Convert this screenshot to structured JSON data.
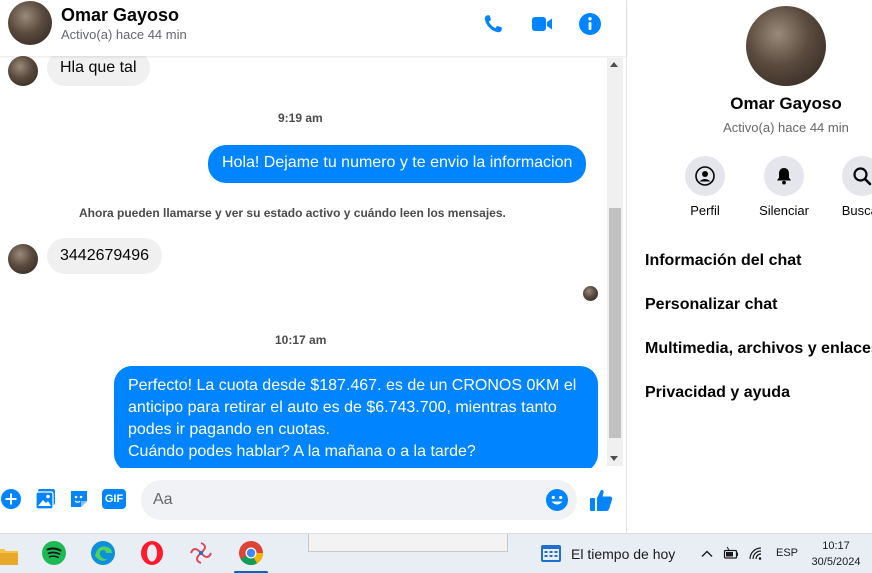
{
  "header": {
    "contact_name": "Omar Gayoso",
    "status": "Activo(a) hace 44 min",
    "icons": [
      "phone-icon",
      "video-icon",
      "info-icon"
    ]
  },
  "messages": {
    "in_1": "Hla que tal",
    "time_1": "9:19 am",
    "out_1": "Hola! Dejame tu numero y te envio la informacion",
    "notice": "Ahora pueden llamarse y ver su estado activo y cuándo leen los mensajes.",
    "in_2": "3442679496",
    "time_2": "10:17 am",
    "out_2_lines": [
      "Perfecto! La cuota desde $187.467. es de un CRONOS 0KM el",
      "anticipo para retirar el auto es de $6.743.700, mientras tanto",
      "podes ir pagando en cuotas.",
      "Cuándo podes hablar? A la mañana o a la tarde?"
    ]
  },
  "composer": {
    "placeholder": "Aa",
    "gif_label": "GIF",
    "icons": [
      "plus-icon",
      "image-icon",
      "sticker-icon",
      "gif-icon",
      "emoji-icon",
      "like-icon"
    ]
  },
  "panel": {
    "name": "Omar Gayoso",
    "status": "Activo(a) hace 44 min",
    "actions": [
      {
        "label": "Perfil",
        "icon": "profile-icon"
      },
      {
        "label": "Silenciar",
        "icon": "bell-icon"
      },
      {
        "label": "Buscar",
        "icon": "search-icon"
      }
    ],
    "menu": [
      "Información del chat",
      "Personalizar chat",
      "Multimedia, archivos y enlaces",
      "Privacidad y ayuda"
    ]
  },
  "taskbar": {
    "apps": [
      "file-explorer-icon",
      "spotify-icon",
      "edge-icon",
      "opera-icon",
      "app-icon",
      "chrome-icon"
    ],
    "weather": "El tiempo de hoy",
    "language": "ESP",
    "time": "10:17",
    "date": "30/5/2024"
  },
  "colors": {
    "accent": "#0084ff",
    "incoming_bubble": "#f0f0f0",
    "text_secondary": "#65676b"
  }
}
